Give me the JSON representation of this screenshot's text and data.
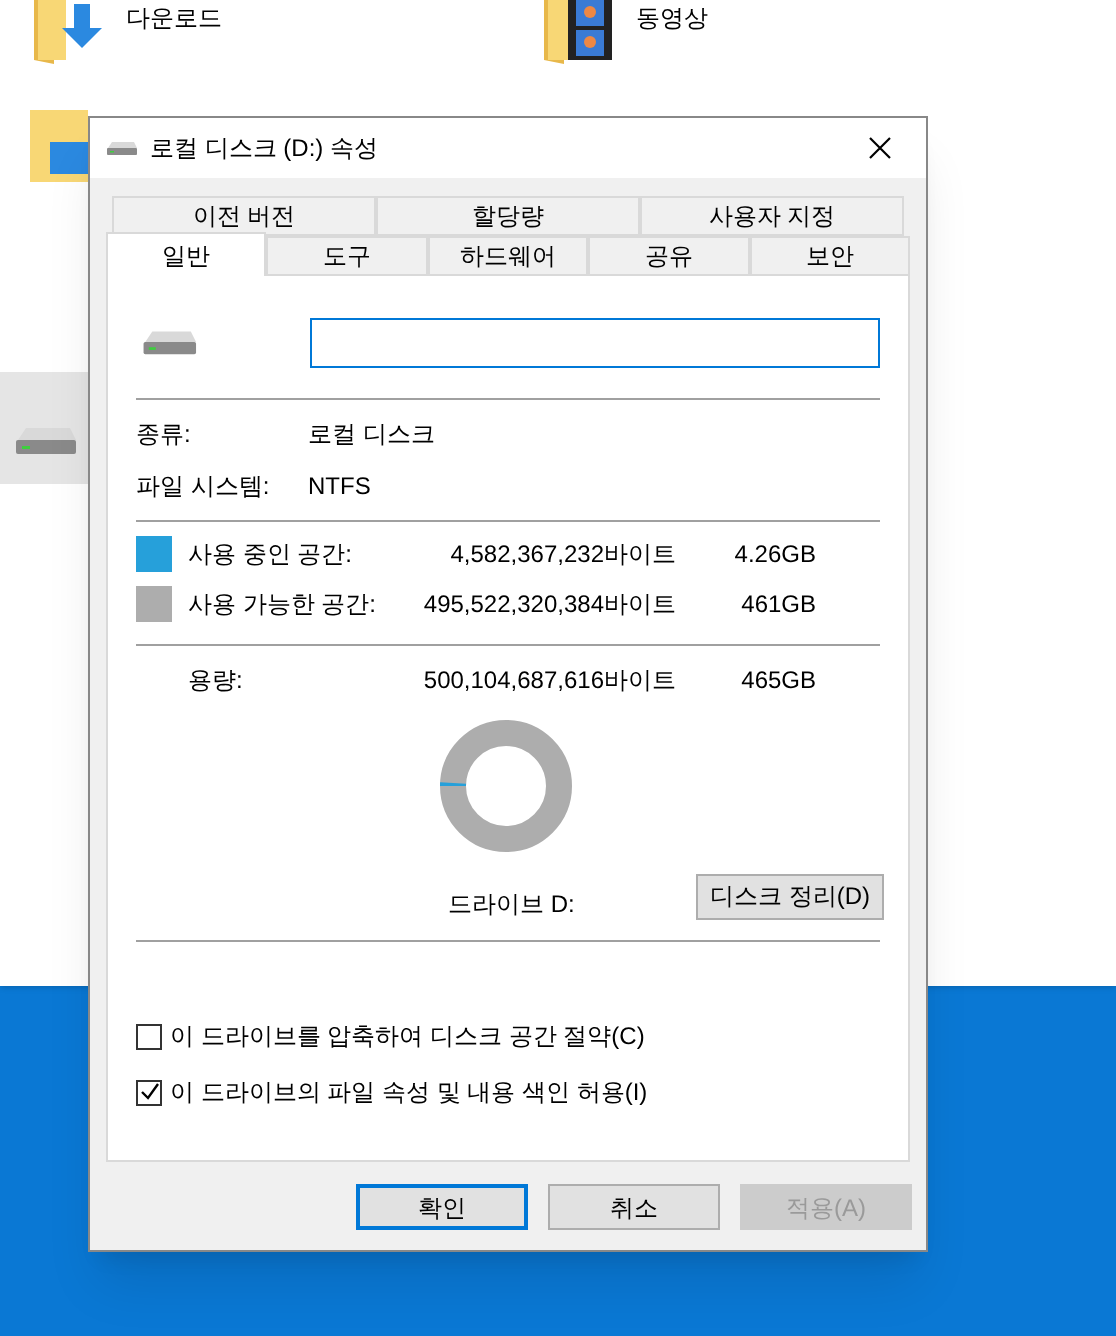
{
  "explorer": {
    "items": [
      {
        "label": "다운로드",
        "kind": "downloads"
      },
      {
        "label": "동영상",
        "kind": "videos"
      }
    ]
  },
  "dialog": {
    "title": "로컬 디스크 (D:) 속성",
    "tab_rows": [
      [
        {
          "label": "이전 버전",
          "selected": false
        },
        {
          "label": "할당량",
          "selected": false
        },
        {
          "label": "사용자 지정",
          "selected": false
        }
      ],
      [
        {
          "label": "일반",
          "selected": true
        },
        {
          "label": "도구",
          "selected": false
        },
        {
          "label": "하드웨어",
          "selected": false
        },
        {
          "label": "공유",
          "selected": false
        },
        {
          "label": "보안",
          "selected": false
        }
      ]
    ],
    "type": {
      "label": "종류:",
      "value": "로컬 디스크"
    },
    "file_system": {
      "label": "파일 시스템:",
      "value": "NTFS"
    },
    "space": [
      {
        "label": "사용 중인 공간:",
        "bytes": "4,582,367,232바이트",
        "size": "4.26GB",
        "color": "#26a0da"
      },
      {
        "label": "사용 가능한 공간:",
        "bytes": "495,522,320,384바이트",
        "size": "461GB",
        "color": "#adadad"
      }
    ],
    "capacity": {
      "label": "용량:",
      "bytes": "500,104,687,616바이트",
      "size": "465GB"
    },
    "usage": {
      "level": 0.009
    },
    "drive_label": "드라이브 D:",
    "cleanup_button": "디스크 정리(D)",
    "options": [
      {
        "label": "이 드라이브를 압축하여 디스크 공간 절약(C)",
        "checked": false
      },
      {
        "label": "이 드라이브의 파일 속성 및 내용 색인 허용(I)",
        "checked": true
      }
    ],
    "buttons": [
      {
        "label": "확인",
        "default": true,
        "disabled": false
      },
      {
        "label": "취소",
        "default": false,
        "disabled": false
      },
      {
        "label": "적용(A)",
        "default": false,
        "disabled": true
      }
    ]
  }
}
